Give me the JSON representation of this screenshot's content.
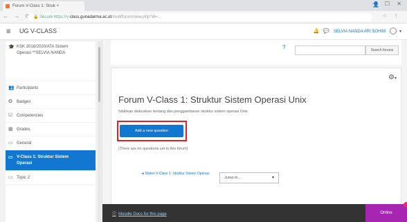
{
  "browser": {
    "tab_title": "Forum V-Class 1: Struk ×",
    "tab_close": "×",
    "user_icon": "person-icon",
    "window_controls": "— ☐ ✕",
    "nav_buttons": "← → ⟳",
    "url_prefix": "🔒 Secure  https://v-",
    "url_domain": "class.gunadarma.ac.id",
    "url_rest": "/mod/forum/view.php?id=...",
    "addr_icons": "☆ ⋮"
  },
  "header": {
    "brand": "UG V-CLASS",
    "user_name": "SELVIA NANDA ARI SOHIM",
    "icons": [
      "bell-icon",
      "chat-icon"
    ]
  },
  "sidebar": {
    "items": [
      {
        "icon": "graduation-cap-icon",
        "label": "KSK 2018/2020/ATA Sistem Operasi **SELVIA NANDA"
      },
      {
        "icon": "users-icon",
        "label": "Participants"
      },
      {
        "icon": "badge-icon",
        "label": "Badges"
      },
      {
        "icon": "check-icon",
        "label": "Competencies"
      },
      {
        "icon": "grades-icon",
        "label": "Grades"
      },
      {
        "icon": "folder-icon",
        "label": "General"
      },
      {
        "icon": "folder-icon",
        "label": "V-Class 1: Struktur Sistem Operasi"
      },
      {
        "icon": "folder-icon",
        "label": "Topic 2"
      }
    ]
  },
  "search": {
    "button_label": "Search forums",
    "placeholder": ""
  },
  "forum": {
    "title": "Forum V-Class 1: Struktur Sistem Operasi Unix",
    "intro": "Silahkan diskusikan tentang dan penggambaran struktur sistem operasi Unix",
    "add_button": "Add a new question",
    "no_questions": "(There are no questions yet in this forum)",
    "prev_link": "◄ Materi V-Class 1: Struktur Sistem Operasi",
    "jump_to": "Jump to...",
    "jump_caret": "▾"
  },
  "footer": {
    "docs_link": "Moodle Docs for this page",
    "online_label": "Online"
  },
  "colors": {
    "accent": "#1177d1",
    "highlight_border": "#e02020",
    "footer_bg": "#333333",
    "online_badge": "#a626b2"
  }
}
